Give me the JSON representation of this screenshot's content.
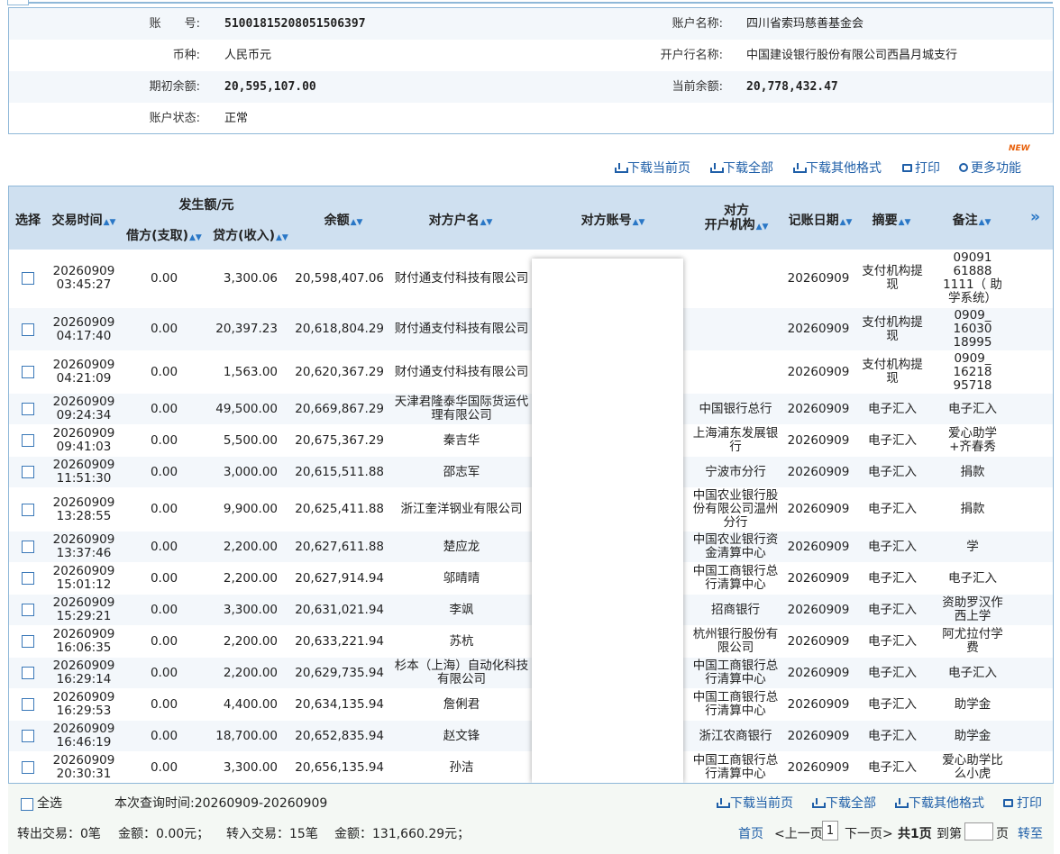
{
  "account_info": {
    "acct_no_label": "账　　号:",
    "acct_no": "51001815208051506397",
    "acct_name_label": "账户名称:",
    "acct_name": "四川省索玛慈善基金会",
    "currency_label": "币种:",
    "currency": "人民币元",
    "bank_label": "开户行名称:",
    "bank": "中国建设银行股份有限公司西昌月城支行",
    "opening_label": "期初余额:",
    "opening": "20,595,107.00",
    "current_label": "当前余额:",
    "current": "20,778,432.47",
    "status_label": "账户状态:",
    "status": "正常"
  },
  "toolbar": {
    "download_page": "下载当前页",
    "download_all": "下载全部",
    "download_other": "下载其他格式",
    "print": "打印",
    "more": "更多功能",
    "new_badge": "NEW"
  },
  "table": {
    "headers": {
      "select": "选择",
      "time": "交易时间",
      "amount_group": "发生额/元",
      "debit": "借方(支取)",
      "credit": "贷方(收入)",
      "balance": "余额",
      "cp_name": "对方户名",
      "cp_acct": "对方账号",
      "cp_bank_1": "对方",
      "cp_bank_2": "开户机构",
      "post_date": "记账日期",
      "summary": "摘要",
      "note": "备注",
      "more": "»"
    },
    "rows": [
      {
        "date": "20260909",
        "time": "03:45:27",
        "debit": "0.00",
        "credit": "3,300.06",
        "balance": "20,598,407.06",
        "name": "财付通支付科技有限公司",
        "bank": "",
        "post": "20260909",
        "summary": "支付机构提现",
        "note": "09091 61888 1111（ 助学系统）"
      },
      {
        "date": "20260909",
        "time": "04:17:40",
        "debit": "0.00",
        "credit": "20,397.23",
        "balance": "20,618,804.29",
        "name": "财付通支付科技有限公司",
        "bank": "",
        "post": "20260909",
        "summary": "支付机构提现",
        "note": "0909_ 16030 18995"
      },
      {
        "date": "20260909",
        "time": "04:21:09",
        "debit": "0.00",
        "credit": "1,563.00",
        "balance": "20,620,367.29",
        "name": "财付通支付科技有限公司",
        "bank": "",
        "post": "20260909",
        "summary": "支付机构提现",
        "note": "0909_ 16218 95718"
      },
      {
        "date": "20260909",
        "time": "09:24:34",
        "debit": "0.00",
        "credit": "49,500.00",
        "balance": "20,669,867.29",
        "name": "天津君隆泰华国际货运代理有限公司",
        "bank": "中国银行总行",
        "post": "20260909",
        "summary": "电子汇入",
        "note": "电子汇入"
      },
      {
        "date": "20260909",
        "time": "09:41:03",
        "debit": "0.00",
        "credit": "5,500.00",
        "balance": "20,675,367.29",
        "name": "秦吉华",
        "bank": "上海浦东发展银行",
        "post": "20260909",
        "summary": "电子汇入",
        "note": "爱心助学+齐春秀"
      },
      {
        "date": "20260909",
        "time": "11:51:30",
        "debit": "0.00",
        "credit": "3,000.00",
        "balance": "20,615,511.88",
        "name": "邵志军",
        "bank": "宁波市分行",
        "post": "20260909",
        "summary": "电子汇入",
        "note": "捐款"
      },
      {
        "date": "20260909",
        "time": "13:28:55",
        "debit": "0.00",
        "credit": "9,900.00",
        "balance": "20,625,411.88",
        "name": "浙江奎洋钢业有限公司",
        "bank": "中国农业银行股份有限公司温州分行",
        "post": "20260909",
        "summary": "电子汇入",
        "note": "捐款"
      },
      {
        "date": "20260909",
        "time": "13:37:46",
        "debit": "0.00",
        "credit": "2,200.00",
        "balance": "20,627,611.88",
        "name": "楚应龙",
        "bank": "中国农业银行资金清算中心",
        "post": "20260909",
        "summary": "电子汇入",
        "note": "学"
      },
      {
        "date": "20260909",
        "time": "15:01:12",
        "debit": "0.00",
        "credit": "2,200.00",
        "balance": "20,627,914.94",
        "name": "邬晴晴",
        "bank": "中国工商银行总行清算中心",
        "post": "20260909",
        "summary": "电子汇入",
        "note": "电子汇入"
      },
      {
        "date": "20260909",
        "time": "15:29:21",
        "debit": "0.00",
        "credit": "3,300.00",
        "balance": "20,631,021.94",
        "name": "李飒",
        "bank": "招商银行",
        "post": "20260909",
        "summary": "电子汇入",
        "note": "资助罗汉作西上学"
      },
      {
        "date": "20260909",
        "time": "16:06:35",
        "debit": "0.00",
        "credit": "2,200.00",
        "balance": "20,633,221.94",
        "name": "苏杭",
        "bank": "杭州银行股份有限公司",
        "post": "20260909",
        "summary": "电子汇入",
        "note": "阿尤拉付学费"
      },
      {
        "date": "20260909",
        "time": "16:29:14",
        "debit": "0.00",
        "credit": "2,200.00",
        "balance": "20,629,735.94",
        "name": "杉本（上海）自动化科技有限公司",
        "bank": "中国工商银行总行清算中心",
        "post": "20260909",
        "summary": "电子汇入",
        "note": "电子汇入"
      },
      {
        "date": "20260909",
        "time": "16:29:53",
        "debit": "0.00",
        "credit": "4,400.00",
        "balance": "20,634,135.94",
        "name": "詹俐君",
        "bank": "中国工商银行总行清算中心",
        "post": "20260909",
        "summary": "电子汇入",
        "note": "助学金"
      },
      {
        "date": "20260909",
        "time": "16:46:19",
        "debit": "0.00",
        "credit": "18,700.00",
        "balance": "20,652,835.94",
        "name": "赵文锋",
        "bank": "浙江农商银行",
        "post": "20260909",
        "summary": "电子汇入",
        "note": "助学金"
      },
      {
        "date": "20260909",
        "time": "20:30:31",
        "debit": "0.00",
        "credit": "3,300.00",
        "balance": "20,656,135.94",
        "name": "孙洁",
        "bank": "中国工商银行总行清算中心",
        "post": "20260909",
        "summary": "电子汇入",
        "note": "爱心助学比么小虎"
      }
    ]
  },
  "footer": {
    "select_all": "全选",
    "query_time": "本次查询时间:20260909-20260909",
    "download_page": "下载当前页",
    "download_all": "下载全部",
    "download_other": "下载其他格式",
    "print": "打印",
    "out_tx": "转出交易：0笔",
    "out_amt": "金额：0.00元；",
    "in_tx": "转入交易：15笔",
    "in_amt": "金额：131,660.29元；",
    "first": "首页",
    "prev": "<上一页",
    "page": "1",
    "next": "下一页>",
    "total": "共1页",
    "goto_pre": "到第",
    "goto_post": "页",
    "goto": "转至"
  }
}
